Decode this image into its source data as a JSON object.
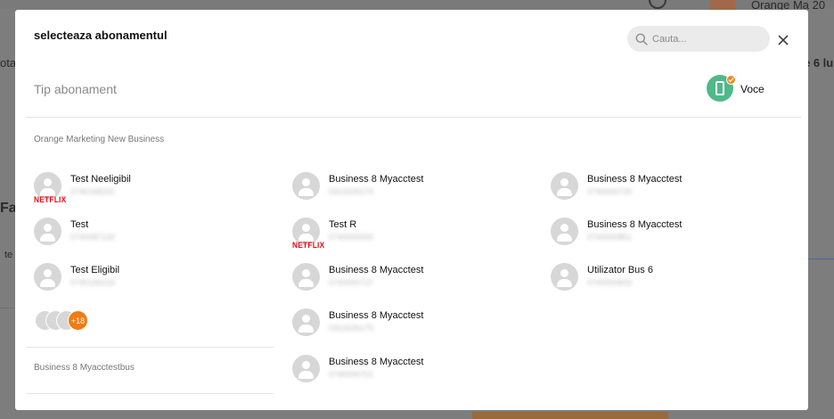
{
  "background": {
    "top_right_text": "Orange Ma 20",
    "left_text_1": "ota",
    "left_text_2": "Fa",
    "left_text_3": "te",
    "right_text": "e 6 lu"
  },
  "modal": {
    "title": "selecteaza abonamentul",
    "search_placeholder": "Cauta...",
    "tip_label": "Tip abonament",
    "voce_label": "Voce",
    "groups": [
      {
        "title": "Orange Marketing New Business",
        "more_count": "+18",
        "items": [
          {
            "name": "Test Neeligibil",
            "number": "0740168231",
            "badge": "NETFLIX"
          },
          {
            "name": "Test",
            "number": "0740087132",
            "badge": ""
          },
          {
            "name": "Test Eligibil",
            "number": "0740156233",
            "badge": ""
          }
        ]
      },
      {
        "title": "Business 8 Myacctestbus"
      }
    ],
    "column2": [
      {
        "name": "Business 8 Myacctest",
        "number": "0313226174",
        "badge": ""
      },
      {
        "name": "Test R",
        "number": "0740000000",
        "badge": "NETFLIX"
      },
      {
        "name": "Business 8 Myacctest",
        "number": "0740000727",
        "badge": ""
      },
      {
        "name": "Business 8 Myacctest",
        "number": "0313226175",
        "badge": ""
      },
      {
        "name": "Business 8 Myacctest",
        "number": "0740000701",
        "badge": ""
      }
    ],
    "column3": [
      {
        "name": "Business 8 Myacctest",
        "number": "0740000729",
        "badge": ""
      },
      {
        "name": "Business 8 Myacctest",
        "number": "0740000851",
        "badge": ""
      },
      {
        "name": "Utilizator Bus 6",
        "number": "0740000603",
        "badge": ""
      }
    ]
  },
  "colors": {
    "accent_orange": "#f07c12",
    "netflix_red": "#e50914",
    "voce_green": "#4fb98a"
  }
}
